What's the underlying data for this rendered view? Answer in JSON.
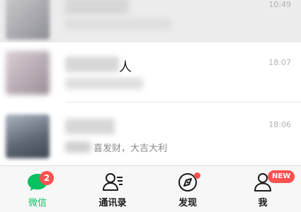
{
  "chats": [
    {
      "time": "10:49",
      "name": "",
      "preview": ""
    },
    {
      "time": "18:07",
      "name": "人",
      "preview": ""
    },
    {
      "time": "18:06",
      "name": "",
      "preview": "喜发财，大吉大利"
    }
  ],
  "tabbar": {
    "tabs": [
      {
        "label": "微信",
        "icon": "chat-icon",
        "badge": "2"
      },
      {
        "label": "通讯录",
        "icon": "contacts-icon",
        "badge": ""
      },
      {
        "label": "发现",
        "icon": "compass-icon",
        "badge": ""
      },
      {
        "label": "我",
        "icon": "person-icon",
        "badge": "NEW"
      }
    ],
    "active_index": 0
  },
  "colors": {
    "accent": "#07c160",
    "badge": "#fa5151"
  }
}
